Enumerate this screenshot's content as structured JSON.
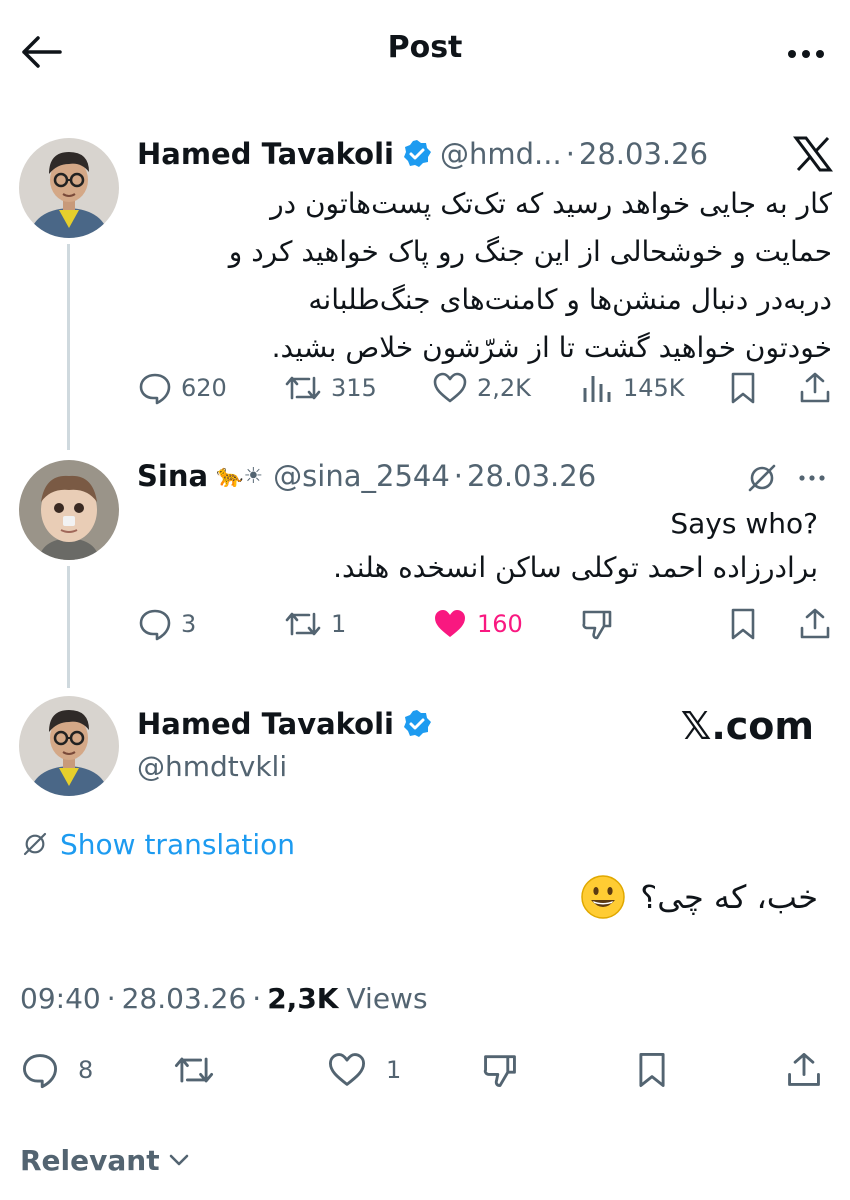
{
  "header": {
    "title": "Post"
  },
  "quoted_tweet": {
    "author_name": "Hamed Tavakoli",
    "handle": "@hmd...",
    "separator": "·",
    "date": "28.03.26",
    "text_lines": [
      "کار به جایی خواهد رسید که تک‌تک پست‌هاتون در",
      "حمایت و خوشحالی از این جنگ رو پاک خواهید کرد و",
      "دربه‌در دنبال منشن‌ها و کامنت‌های جنگ‌طلبانه",
      "خودتون خواهید گشت تا از شرّشون خلاص بشید."
    ],
    "replies": "620",
    "reposts": "315",
    "likes": "2,2K",
    "views": "145K"
  },
  "reply_tweet": {
    "author_name": "Sina",
    "name_emoji": "🐆☀",
    "handle": "@sina_2544",
    "separator": "·",
    "date": "28.03.26",
    "text_line1": "Says who?",
    "text_line2": "برادرزاده احمد توکلی ساکن انسخده هلند.",
    "replies": "3",
    "reposts": "1",
    "likes": "160"
  },
  "main_tweet": {
    "author_name": "Hamed Tavakoli",
    "handle": "@hmdtvkli",
    "site_label": "𝕏.com",
    "show_translation": "Show translation",
    "text": "خب، که چی؟",
    "time": "09:40",
    "separator": "·",
    "date": "28.03.26",
    "views_count": "2,3K",
    "views_label": "Views",
    "replies": "8",
    "likes": "1"
  },
  "footer": {
    "sort_label": "Relevant"
  },
  "colors": {
    "accent": "#1d9bf0",
    "like_active": "#f91880",
    "secondary_text": "#536471",
    "thread_line": "#cfd9de"
  }
}
